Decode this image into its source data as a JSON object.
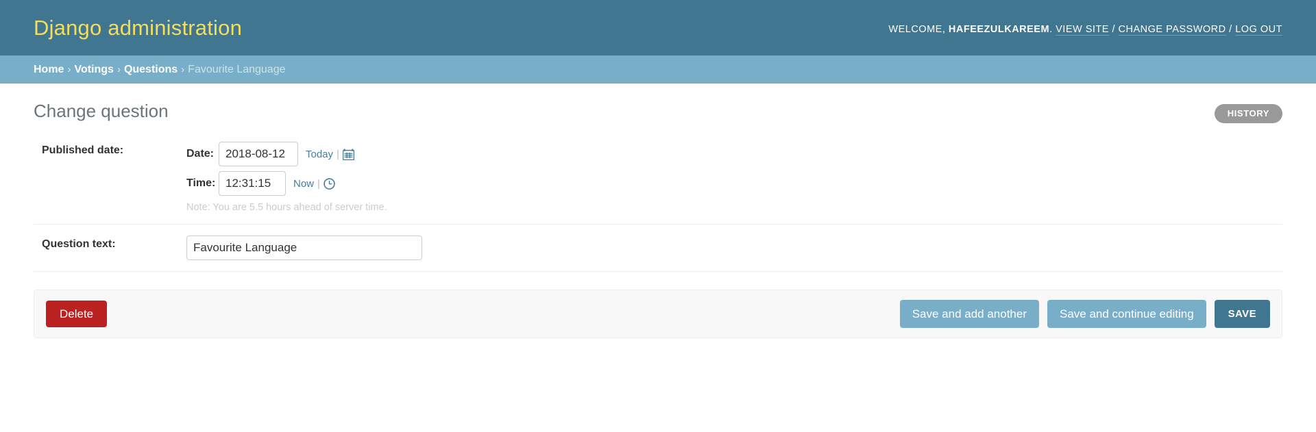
{
  "header": {
    "site_title": "Django administration",
    "user_tools": {
      "welcome_label": "WELCOME,",
      "username": "HAFEEZULKAREEM",
      "period": ".",
      "view_site": "VIEW SITE",
      "sep1": "/",
      "change_password": "CHANGE PASSWORD",
      "sep2": "/",
      "log_out": "LOG OUT"
    }
  },
  "breadcrumbs": {
    "items": [
      {
        "label": "Home",
        "current": false
      },
      {
        "label": "Votings",
        "current": false
      },
      {
        "label": "Questions",
        "current": false
      },
      {
        "label": "Favourite Language",
        "current": true
      }
    ],
    "separator": "›"
  },
  "content": {
    "title": "Change question",
    "history_label": "HISTORY"
  },
  "form": {
    "rows": [
      {
        "label": "Published date:",
        "date": {
          "label": "Date:",
          "value": "2018-08-12",
          "shortcut": "Today",
          "pipe": "|",
          "icon": "calendar-icon"
        },
        "time": {
          "label": "Time:",
          "value": "12:31:15",
          "shortcut": "Now",
          "pipe": "|",
          "icon": "clock-icon"
        },
        "note": "Note: You are 5.5 hours ahead of server time."
      },
      {
        "label": "Question text:",
        "text": {
          "value": "Favourite Language"
        }
      }
    ]
  },
  "submit_row": {
    "delete_label": "Delete",
    "save_add_another_label": "Save and add another",
    "save_continue_label": "Save and continue editing",
    "save_label": "SAVE"
  },
  "colors": {
    "header_bg": "#417690",
    "header_title": "#f5dd5d",
    "breadcrumb_bg": "#79aec8",
    "accent_link": "#447e9b",
    "delete_red": "#ba2121",
    "history_gray": "#999999",
    "button_light": "#79aec8",
    "button_dark": "#417690"
  }
}
